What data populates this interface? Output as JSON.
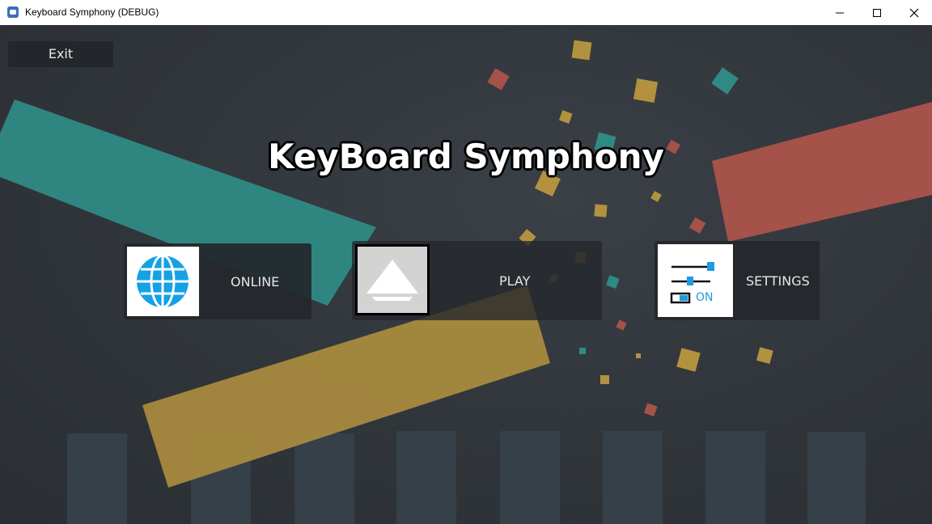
{
  "window": {
    "title": "Keyboard Symphony (DEBUG)",
    "controls": [
      "minimize-icon",
      "maximize-icon",
      "close-icon"
    ]
  },
  "menu": {
    "exit_label": "Exit",
    "game_title": "KeyBoard Symphony",
    "online_label": "ONLINE",
    "play_label": "PLAY",
    "settings_label": "SETTINGS",
    "settings_toggle_label": "ON"
  },
  "colors": {
    "teal": "#2f8a84",
    "coral": "#a4524a",
    "gold": "#a88a3e",
    "online_icon": "#14a1e6",
    "settings_accent": "#1e9be0"
  }
}
